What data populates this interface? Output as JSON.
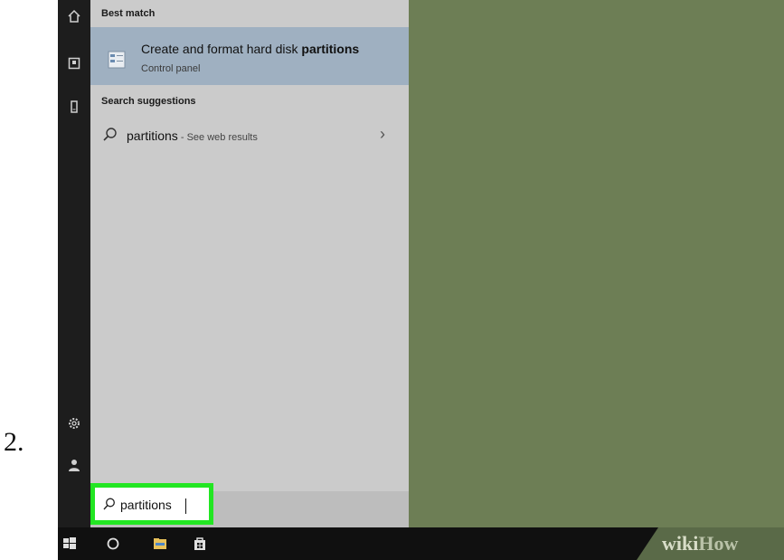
{
  "step_number": "2.",
  "start_menu": {
    "best_match_header": "Best match",
    "best_match": {
      "title_prefix": "Create and format hard disk ",
      "title_bold": "partitions",
      "subtitle": "Control panel",
      "icon": "disk-management-icon"
    },
    "suggestions_header": "Search suggestions",
    "suggestions": [
      {
        "query": "partitions",
        "hint": " - See web results",
        "icon": "search-icon"
      }
    ],
    "rail_icons": [
      "home-icon",
      "documents-icon",
      "device-icon",
      "settings-icon",
      "user-icon"
    ]
  },
  "search_box": {
    "value": "partitions",
    "icon": "search-icon"
  },
  "taskbar": {
    "icons": [
      "windows-start-icon",
      "cortana-icon",
      "file-explorer-icon",
      "store-icon"
    ]
  },
  "watermark": {
    "wiki": "wiki",
    "how": "How"
  },
  "colors": {
    "desktop": "#6d7e55",
    "panel": "#cbcbcb",
    "selected_result": "#9fb0c1",
    "highlight_border": "#22e622",
    "taskbar": "#101010"
  }
}
